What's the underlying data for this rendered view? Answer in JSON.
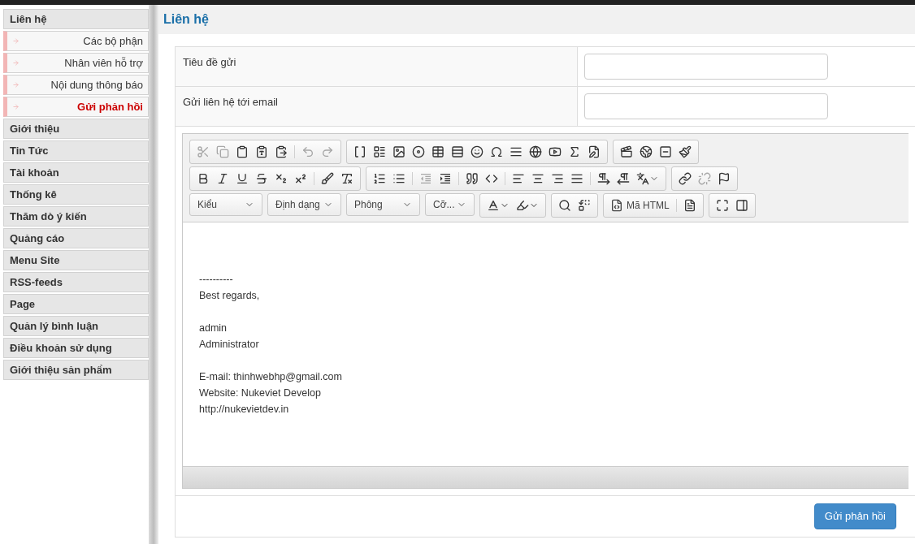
{
  "sidebar": {
    "items": [
      {
        "label": "Liên hệ",
        "children": [
          {
            "label": "Các bộ phận",
            "selected": false
          },
          {
            "label": "Nhân viên hỗ trợ",
            "selected": false
          },
          {
            "label": "Nội dung thông báo",
            "selected": false
          },
          {
            "label": "Gửi phản hồi",
            "selected": true
          }
        ]
      },
      {
        "label": "Giới thiệu"
      },
      {
        "label": "Tin Tức"
      },
      {
        "label": "Tài khoản"
      },
      {
        "label": "Thống kê"
      },
      {
        "label": "Thăm dò ý kiến"
      },
      {
        "label": "Quảng cáo"
      },
      {
        "label": "Menu Site"
      },
      {
        "label": "RSS-feeds"
      },
      {
        "label": "Page"
      },
      {
        "label": "Quản lý bình luận"
      },
      {
        "label": "Điều khoản sử dụng"
      },
      {
        "label": "Giới thiệu sản phẩm"
      }
    ]
  },
  "page_title": "Liên hệ",
  "form": {
    "fields": [
      {
        "label": "Tiêu đề gửi"
      },
      {
        "label": "Gửi liên hệ tới email"
      }
    ]
  },
  "editor": {
    "toolbar_rows": [
      [
        [
          {
            "kind": "cut",
            "disabled": true
          },
          {
            "kind": "copy",
            "disabled": true
          },
          {
            "kind": "paste",
            "disabled": false
          },
          {
            "kind": "paste-text",
            "disabled": false
          },
          {
            "kind": "paste-word",
            "disabled": false
          },
          {
            "kind": "sep"
          },
          {
            "kind": "undo",
            "disabled": true
          },
          {
            "kind": "redo",
            "disabled": true
          }
        ],
        [
          {
            "kind": "paragraph",
            "disabled": false
          },
          {
            "kind": "blocks",
            "disabled": false
          },
          {
            "kind": "image",
            "disabled": false
          },
          {
            "kind": "flash",
            "disabled": false
          },
          {
            "kind": "table",
            "disabled": false
          },
          {
            "kind": "hr",
            "disabled": false
          },
          {
            "kind": "smiley",
            "disabled": false
          },
          {
            "kind": "omega",
            "disabled": false
          },
          {
            "kind": "pagebreak",
            "disabled": false
          },
          {
            "kind": "globe",
            "disabled": false
          },
          {
            "kind": "youtube",
            "disabled": false
          },
          {
            "kind": "formula",
            "disabled": false
          },
          {
            "kind": "edit",
            "disabled": false
          }
        ],
        [
          {
            "kind": "video",
            "disabled": false
          },
          {
            "kind": "earth",
            "disabled": false
          },
          {
            "kind": "minus",
            "disabled": false
          },
          {
            "kind": "brush-link",
            "disabled": false
          }
        ]
      ],
      [
        [
          {
            "kind": "bold",
            "disabled": false
          },
          {
            "kind": "italic",
            "disabled": false
          },
          {
            "kind": "underline",
            "disabled": false
          },
          {
            "kind": "strike",
            "disabled": false
          },
          {
            "kind": "sub",
            "disabled": false
          },
          {
            "kind": "sup",
            "disabled": false
          },
          {
            "kind": "sep"
          },
          {
            "kind": "paintbrush",
            "disabled": false
          },
          {
            "kind": "clear",
            "disabled": false
          }
        ],
        [
          {
            "kind": "ol",
            "disabled": false
          },
          {
            "kind": "ul",
            "disabled": false
          },
          {
            "kind": "sep"
          },
          {
            "kind": "outdent",
            "disabled": true
          },
          {
            "kind": "indent",
            "disabled": false
          },
          {
            "kind": "sep"
          },
          {
            "kind": "quote",
            "disabled": false
          },
          {
            "kind": "div",
            "disabled": false
          },
          {
            "kind": "sep"
          },
          {
            "kind": "left",
            "disabled": false
          },
          {
            "kind": "center",
            "disabled": false
          },
          {
            "kind": "right",
            "disabled": false
          },
          {
            "kind": "justify",
            "disabled": false
          },
          {
            "kind": "sep"
          },
          {
            "kind": "ltr",
            "disabled": false
          },
          {
            "kind": "rtl",
            "disabled": false
          },
          {
            "kind": "language",
            "disabled": false
          }
        ],
        [
          {
            "kind": "link",
            "disabled": false
          },
          {
            "kind": "unlink",
            "disabled": true
          },
          {
            "kind": "anchor",
            "disabled": false
          }
        ]
      ]
    ],
    "dropdowns": [
      {
        "label": "Kiểu"
      },
      {
        "label": "Định dạng"
      },
      {
        "label": "Phông"
      },
      {
        "label": "Cỡ..."
      }
    ],
    "source_button": "Mã HTML",
    "paragraphs": [
      [
        "----------",
        "Best regards,"
      ],
      [
        "admin",
        "Administrator"
      ],
      [
        "E-mail: thinhwebhp@gmail.com",
        "Website: Nukeviet Develop",
        "http://nukevietdev.in"
      ]
    ]
  },
  "submit_button": "Gửi phản hồi"
}
